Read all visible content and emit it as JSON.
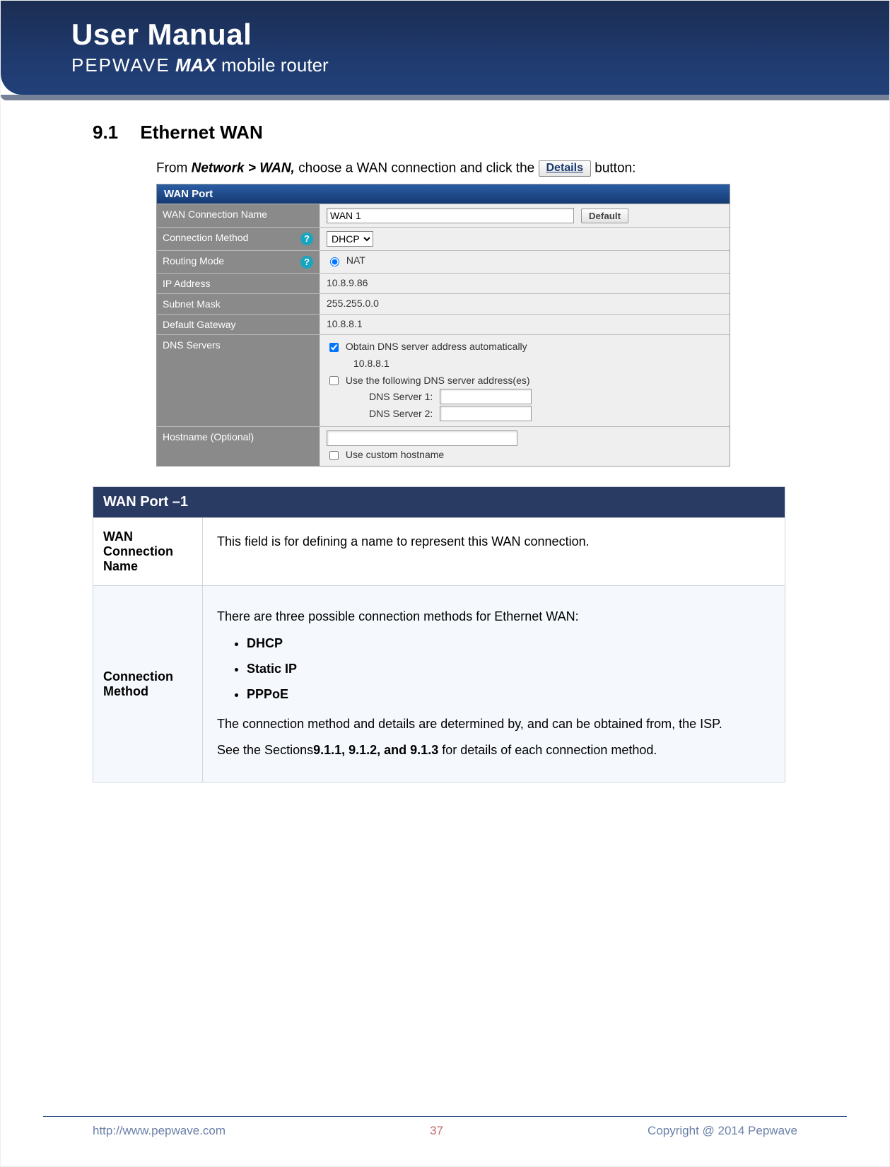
{
  "header": {
    "title": "User Manual",
    "brand": "PEPWAVE",
    "model": "MAX",
    "tagline": "mobile router"
  },
  "section": {
    "number": "9.1",
    "title": "Ethernet WAN"
  },
  "intro": {
    "prefix": "From",
    "breadcrumb": "Network > WAN,",
    "middle": " choose a WAN connection and click the",
    "button_label": "Details",
    "suffix": "button:"
  },
  "panel": {
    "title": "WAN Port",
    "rows": {
      "wan_conn_name": {
        "label": "WAN Connection Name",
        "value": "WAN 1",
        "default_btn": "Default"
      },
      "conn_method": {
        "label": "Connection Method",
        "value": "DHCP"
      },
      "routing_mode": {
        "label": "Routing Mode",
        "value": "NAT"
      },
      "ip_address": {
        "label": "IP Address",
        "value": "10.8.9.86"
      },
      "subnet_mask": {
        "label": "Subnet Mask",
        "value": "255.255.0.0"
      },
      "default_gateway": {
        "label": "Default Gateway",
        "value": "10.8.8.1"
      },
      "dns_servers": {
        "label": "DNS Servers",
        "auto_label": "Obtain DNS server address automatically",
        "auto_value": "10.8.8.1",
        "manual_label": "Use the following DNS server address(es)",
        "server1_label": "DNS Server 1:",
        "server2_label": "DNS Server 2:"
      },
      "hostname": {
        "label": "Hostname (Optional)",
        "custom_label": "Use custom hostname"
      }
    }
  },
  "desc_table": {
    "header": "WAN Port –1",
    "rows": [
      {
        "label": "WAN Connection Name",
        "body_plain": "This field is for defining a name to represent this WAN connection."
      },
      {
        "label": "Connection Method",
        "p1": "There are three possible connection methods for Ethernet WAN:",
        "items": [
          "DHCP",
          "Static IP",
          "PPPoE"
        ],
        "p2": "The connection method and details are determined by, and can be obtained from, the ISP.",
        "p3_prefix": "See the Sections",
        "p3_bold": "9.1.1, 9.1.2, and 9.1.3",
        "p3_suffix": " for details of each connection method."
      }
    ]
  },
  "footer": {
    "url": "http://www.pepwave.com",
    "page": "37",
    "copyright": "Copyright @ 2014 Pepwave"
  }
}
